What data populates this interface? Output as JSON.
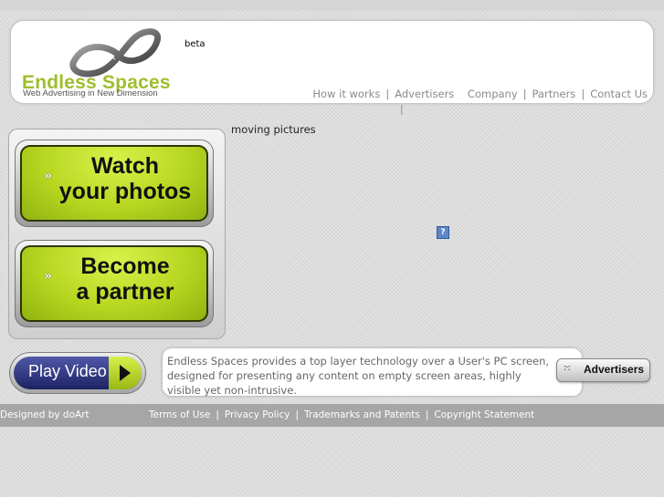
{
  "header": {
    "logo_name": "Endless Spaces",
    "logo_tagline": "Web Advertising in New Dimension",
    "beta_label": "beta",
    "nav": [
      {
        "label": "How it works"
      },
      {
        "label": "Advertisers"
      },
      {
        "label": "Company"
      },
      {
        "label": "Partners"
      },
      {
        "label": "Contact Us"
      }
    ],
    "nav_separator": "|"
  },
  "main": {
    "moving_text": "moving pictures",
    "help_icon_symbol": "?"
  },
  "promo": {
    "watch_label": "Watch\nyour photos",
    "partner_label": "Become\na partner",
    "chevron_symbol": "»"
  },
  "play_video": {
    "label": "Play Video"
  },
  "description": "Endless Spaces provides a top layer technology over a User's PC screen, designed for presenting any content on empty screen areas, highly visible yet non-intrusive.",
  "advertisers_button": {
    "label": "Advertisers",
    "dots": ":·:"
  },
  "footer": {
    "credit": "Designed by doArt",
    "links": [
      {
        "label": "Terms of Use"
      },
      {
        "label": "Privacy Policy"
      },
      {
        "label": "Trademarks and Patents"
      },
      {
        "label": "Copyright Statement"
      }
    ],
    "separator": "|"
  },
  "colors": {
    "brand_green": "#9fbe2c",
    "button_green": "#b6d620",
    "play_blue": "#1d2363",
    "footer_gray": "#a6a6a6"
  }
}
